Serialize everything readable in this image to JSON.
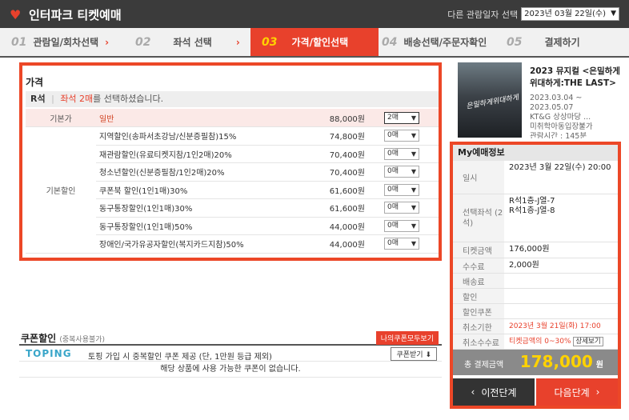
{
  "brand": {
    "name": "인터파크 티켓예매"
  },
  "date_select": {
    "label": "다른 관람일자 선택",
    "value": "2023년 03월 22일(수)"
  },
  "steps": [
    {
      "num": "01",
      "label": "관람일/회차선택"
    },
    {
      "num": "02",
      "label": "좌석 선택"
    },
    {
      "num": "03",
      "label": "가격/할인선택"
    },
    {
      "num": "04",
      "label": "배송선택/주문자확인"
    },
    {
      "num": "05",
      "label": "결제하기"
    }
  ],
  "price": {
    "title": "가격",
    "grade": "R석",
    "grade_sep": "|",
    "grade_seats": "좌석 2매",
    "grade_msg": "를 선택하셨습니다.",
    "rows": [
      {
        "cat": "기본가",
        "name": "일반",
        "price": "88,000원",
        "qty": "2매"
      },
      {
        "cat": "기본할인",
        "name": "지역할인(송파서초강남/신분증필참)15%",
        "price": "74,800원",
        "qty": "0매"
      },
      {
        "cat": "",
        "name": "재관람할인(유료티켓지참/1인2매)20%",
        "price": "70,400원",
        "qty": "0매"
      },
      {
        "cat": "",
        "name": "청소년할인(신분증필참/1인2매)20%",
        "price": "70,400원",
        "qty": "0매"
      },
      {
        "cat": "",
        "name": "쿠폰북 할인(1인1매)30%",
        "price": "61,600원",
        "qty": "0매"
      },
      {
        "cat": "",
        "name": "동구통장할인(1인1매)30%",
        "price": "61,600원",
        "qty": "0매"
      },
      {
        "cat": "",
        "name": "동구통장할인(1인1매)50%",
        "price": "44,000원",
        "qty": "0매"
      },
      {
        "cat": "",
        "name": "장애인/국가유공자할인(복지카드지참)50%",
        "price": "44,000원",
        "qty": "0매"
      }
    ]
  },
  "coupon": {
    "title": "쿠폰할인",
    "subtitle": "(중복사용불가)",
    "all_btn": "나의쿠폰모두보기",
    "brand": "TOPING",
    "desc": "토핑 가입 시 중복할인 쿠폰 제공 (단, 1만원 등급 제외)",
    "get_btn": "쿠폰받기",
    "none": "해당 상품에 사용 가능한 쿠폰이 없습니다."
  },
  "show": {
    "title": "2023 뮤지컬 <은밀하게 위대하게:THE LAST>",
    "dates": "2023.03.04 ~ 2023.05.07",
    "venue": "KT&G 상상마당 ...",
    "age": "미취학아동입장불가",
    "runtime": "관람시간 : 145분",
    "poster_text": "은밀하게위대하게"
  },
  "my": {
    "title": "My예매정보",
    "date_label": "일시",
    "date_value": "2023년 3월 22일(수) 20:00",
    "seat_label": "선택좌석 (2석)",
    "seat_value1": "R석1층-J열-7",
    "seat_value2": "R석1층-J열-8",
    "ticket_label": "티켓금액",
    "ticket_value": "176,000원",
    "fee_label": "수수료",
    "fee_value": "2,000원",
    "ship_label": "배송료",
    "disc_label": "할인",
    "coupon_label": "할인쿠폰",
    "cancel_label": "취소기한",
    "cancel_value": "2023년 3월 21일(화) 17:00",
    "cancel_fee_label": "취소수수료",
    "cancel_fee_value": "티켓금액의 0~30%",
    "detail_btn": "상세보기",
    "total_label": "총 결제금액",
    "total_value": "178,000",
    "total_unit": "원",
    "prev_btn": "이전단계",
    "next_btn": "다음단계"
  },
  "colors": {
    "accent": "#e8412c",
    "highlight": "#ffd200",
    "topbar": "#3b3b3b"
  }
}
